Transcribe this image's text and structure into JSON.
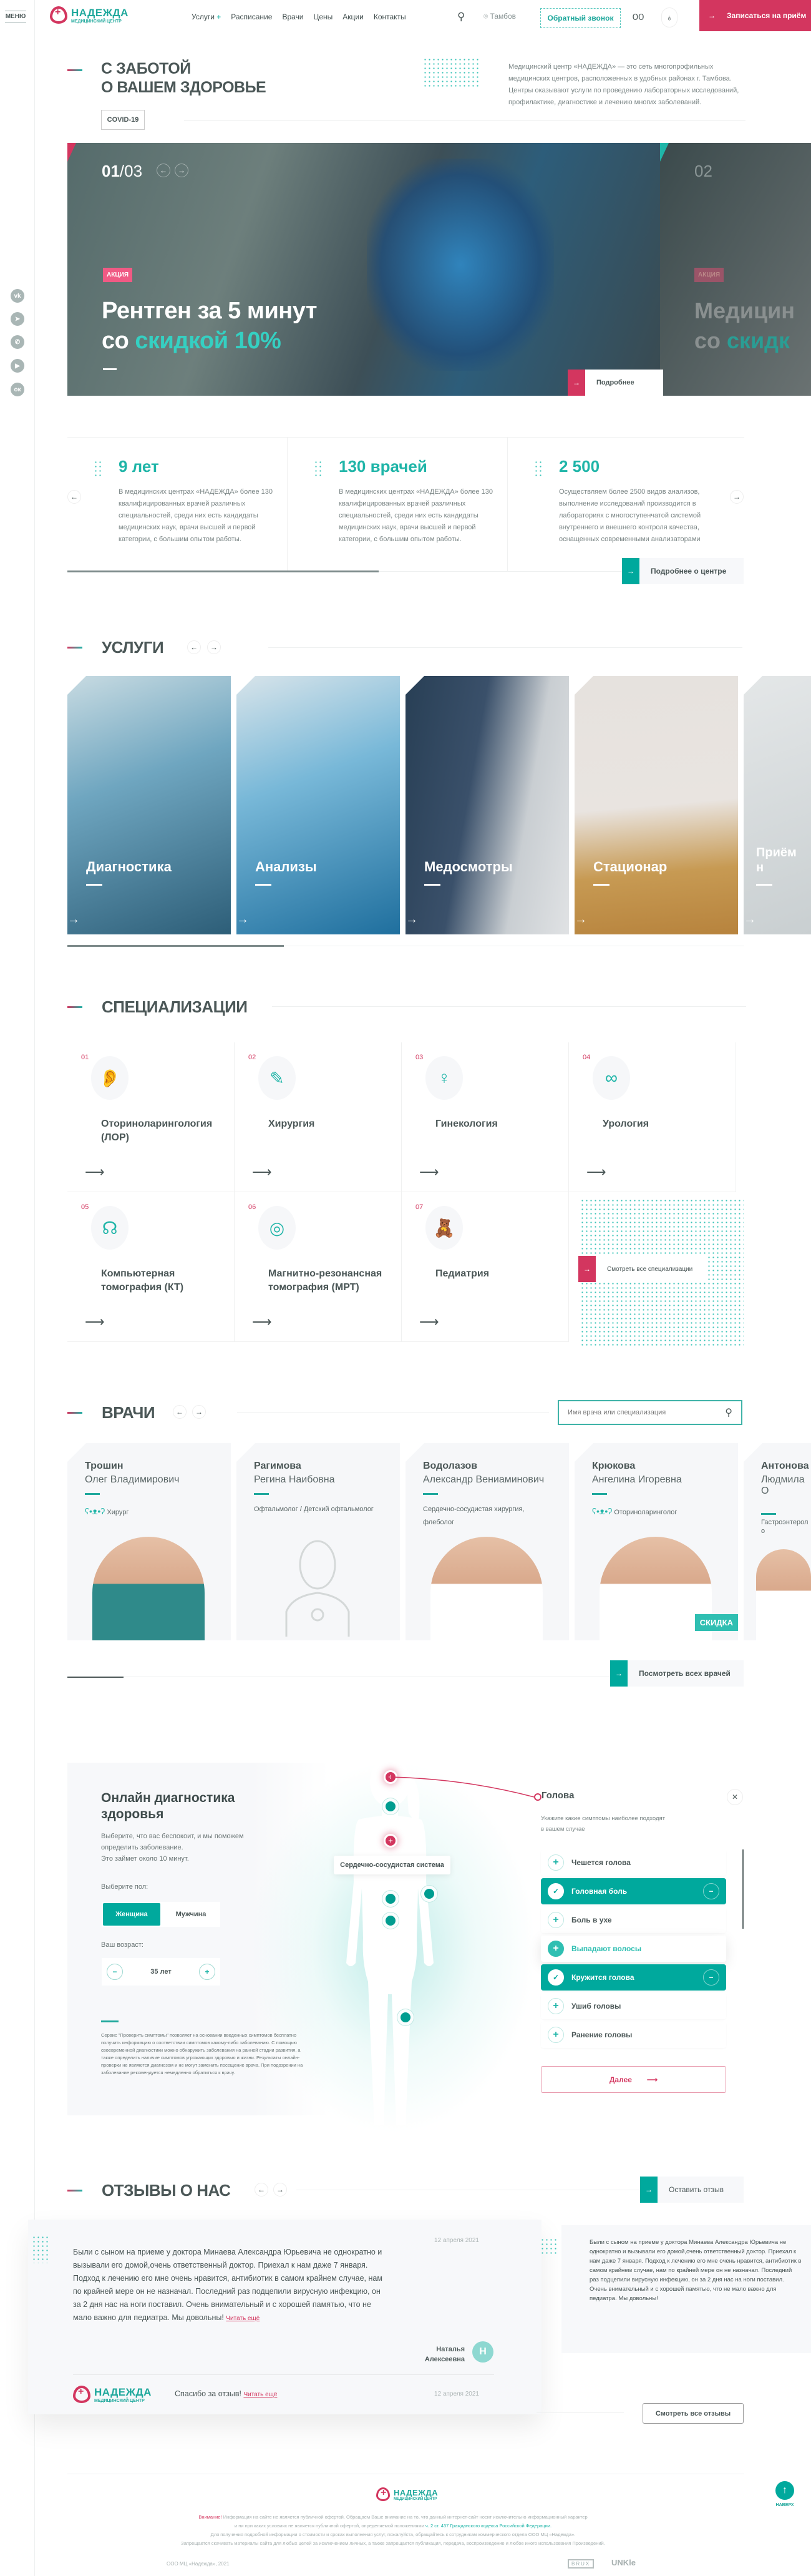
{
  "colors": {
    "teal": "#1fb5a8",
    "pink": "#d3365f",
    "text": "#4b5757"
  },
  "sidebar": {
    "menu_label": "МЕНЮ",
    "social": [
      {
        "icon": "vk-icon",
        "glyph": "vk"
      },
      {
        "icon": "telegram-icon",
        "glyph": "➤"
      },
      {
        "icon": "whatsapp-icon",
        "glyph": "✆"
      },
      {
        "icon": "youtube-icon",
        "glyph": "▶"
      },
      {
        "icon": "odnoklassniki-icon",
        "glyph": "ок"
      }
    ]
  },
  "header": {
    "logo_name": "НАДЕЖДА",
    "logo_sub": "МЕДИЦИНСКИЙ ЦЕНТР",
    "nav": [
      "Услуги",
      "Расписание",
      "Врачи",
      "Цены",
      "Акции",
      "Контакты"
    ],
    "nav_plus": "+",
    "city": "Тамбов",
    "callback": "Обратный звонок",
    "book": "Записаться на приём"
  },
  "intro": {
    "title_line1": "С ЗАБОТОЙ",
    "title_line2": "О ВАШЕМ ЗДОРОВЬЕ",
    "covid": "COVID-19",
    "description": "Медицинский центр «НАДЕЖДА» — это сеть многопрофильных медицинских центров, расположенных в удобных районах г. Тамбова. Центры оказывают услуги по проведению лабораторных исследований, профилактике, диагностике и лечению многих заболеваний."
  },
  "hero": {
    "current": "01",
    "total": "/03",
    "badge": "АКЦИЯ",
    "title_line1": "Рентген за 5 минут",
    "title_pre": "со ",
    "title_accent": "скидкой 10%",
    "more": "Подробнее",
    "next_num": "02",
    "next_badge": "АКЦИЯ",
    "next_title": "Медицин",
    "next_title2_pre": "со ",
    "next_title2_accent": "скидк"
  },
  "stats": {
    "items": [
      {
        "value": "9 лет",
        "text": "В медицинских центрах «НАДЕЖДА» более 130 квалифицированных врачей различных специальностей, среди них есть кандидаты медицинских наук, врачи высшей и первой категории, с большим опытом работы."
      },
      {
        "value": "130 врачей",
        "text": "В медицинских центрах «НАДЕЖДА» более 130 квалифицированных врачей различных специальностей, среди них есть кандидаты медицинских наук, врачи высшей и первой категории, с большим опытом работы."
      },
      {
        "value": "2 500",
        "text": "Осуществляем более 2500 видов анализов, выполнение исследований производится в лабораториях с многоступенчатой системой внутреннего и внешнего контроля качества, оснащенных современными анализаторами"
      }
    ],
    "more": "Подробнее о центре",
    "progress": 0.46
  },
  "services": {
    "title": "УСЛУГИ",
    "items": [
      "Диагностика",
      "Анализы",
      "Медосмотры",
      "Стационар",
      "Приём н"
    ],
    "progress": 0.32
  },
  "specs": {
    "title": "СПЕЦИАЛИЗАЦИИ",
    "items": [
      {
        "num": "01",
        "name": "Оториноларингология (ЛОР)",
        "icon": "ear-icon",
        "glyph": "👂"
      },
      {
        "num": "02",
        "name": "Хирургия",
        "icon": "scalpel-icon",
        "glyph": "✎"
      },
      {
        "num": "03",
        "name": "Гинекология",
        "icon": "uterus-icon",
        "glyph": "♀"
      },
      {
        "num": "04",
        "name": "Урология",
        "icon": "kidneys-icon",
        "glyph": "∞"
      },
      {
        "num": "05",
        "name": "Компьютерная томография (КТ)",
        "icon": "head-brain-icon",
        "glyph": "☊"
      },
      {
        "num": "06",
        "name": "Магнитно-резонансная томография (МРТ)",
        "icon": "mri-scanner-icon",
        "glyph": "◎"
      },
      {
        "num": "07",
        "name": "Педиатрия",
        "icon": "teddy-bear-icon",
        "glyph": "🧸"
      }
    ],
    "all": "Смотреть все специализации"
  },
  "doctors": {
    "title": "ВРАЧИ",
    "search_placeholder": "Имя врача или специализация",
    "items": [
      {
        "surname": "Трошин",
        "name": "Олег Владимирович",
        "spec": "Хирург",
        "kids": true,
        "photo": "#2f8a8a"
      },
      {
        "surname": "Рагимова",
        "name": "Регина Наибовна",
        "spec": "Офтальмолог / Детский офтальмолог",
        "kids": false,
        "photo": ""
      },
      {
        "surname": "Водолазов",
        "name": "Александр Вениаминович",
        "spec": "Сердечно-сосудистая хирургия, флеболог",
        "kids": false,
        "photo": "#ffffff"
      },
      {
        "surname": "Крюкова",
        "name": "Ангелина Игоревна",
        "spec": "Оториноларинголог",
        "kids": true,
        "photo": "#ffffff",
        "badge": "СКИДКА"
      },
      {
        "surname": "Антонова",
        "name": "Людмила О",
        "spec": "Гастроэнтероло",
        "kids": false,
        "photo": "#ffffff"
      }
    ],
    "all": "Посмотреть всех врачей"
  },
  "diag": {
    "title": "Онлайн диагностика здоровья",
    "desc_line1": "Выберите, что вас беспокоит, и мы поможем определить заболевание.",
    "desc_line2": "Это займет около 10 минут.",
    "gender_label": "Выберите пол:",
    "female": "Женщина",
    "male": "Мужчина",
    "age_label": "Ваш возраст:",
    "age": "35 лет",
    "disclaimer": "Сервис \"Проверить симптомы\" позволяет на основании введенных симптомов бесплатно получить информацию о соответствии симптомов какому-либо заболеванию. С помощью своевременной диагностики можно обнаружить заболевания на ранней стадии развития, а также определить наличие симптомов угрожающих здоровью и жизни. Результаты онлайн-проверки не являются диагнозом и не могут заменить посещение врача. При подозрении на заболевание рекомендуется немедленно обратиться к врачу.",
    "tooltip": "Сердечно-сосудистая система",
    "panel_title": "Голова",
    "panel_sub": "Укажите какие симптомы наиболее подходят в вашем случае",
    "symptoms": [
      {
        "label": "Чешется голова",
        "selected": false
      },
      {
        "label": "Головная боль",
        "selected": true
      },
      {
        "label": "Боль в ухе",
        "selected": false
      },
      {
        "label": "Выпадают волосы",
        "selected": false,
        "hover": true
      },
      {
        "label": "Кружится голова",
        "selected": true
      },
      {
        "label": "Ушиб головы",
        "selected": false
      },
      {
        "label": "Ранение головы",
        "selected": false
      }
    ],
    "next": "Далее"
  },
  "reviews": {
    "title": "ОТЗЫВЫ О НАС",
    "leave": "Оставить отзыв",
    "items": [
      {
        "date": "12 апреля 2021",
        "text": "Были с сыном на приеме у доктора Минаева Александра Юрьевича не однократно и вызывали его домой,очень ответственный доктор. Приехал к нам даже 7 января. Подход к лечению его мне очень нравится, антибиотик в самом крайнем случае, нам по крайней мере он не назначал. Последний раз подцепили вирусную инфекцию, он за 2 дня нас на ноги поставил. Очень внимательный и с хорошей памятью, что не мало важно для педиатра. Мы довольны!",
        "more": "Читать ещё",
        "author_line1": "Наталья",
        "author_line2": "Алексеевна",
        "initial": "Н",
        "reply": "Спасибо за отзыв!",
        "reply_more": "Читать ещё",
        "reply_date": "12 апреля 2021"
      },
      {
        "text": "Были с сыном на приеме у доктора Минаева Александра Юрьевича не однократно и вызывали его домой,очень ответственный доктор. Приехал к нам даже 7 января. Подход к лечению его мне очень нравится, антибиотик в самом крайнем случае, нам по крайней мере он не назначал. Последний раз подцепили вирусную инфекцию, он за 2 дня нас на ноги поставил. Очень внимательный и с хорошей памятью, что не мало важно для педиатра. Мы довольны!"
      }
    ],
    "all": "Смотреть все отзывы"
  },
  "footer": {
    "warn": "Внимание!",
    "line1": " Информация на сайте не является публичной офертой. Обращаем Ваше внимание на то, что данный интернет-сайт носит исключительно информационный характер",
    "line2": "и ни при каких условиях не является публичной офертой, определяемой положениями ",
    "law": "ч. 2 ст. 437 Гражданского кодекса Российской Федерации.",
    "line3": "Для получения подробной информации о стоимости и сроках выполнения услуг, пожалуйста, обращайтесь к сотрудникам коммерческого отдела ООО МЦ «Надежда».",
    "line4": "Запрещается скачивать материалы сайта для любых целей за исключением личных, а также запрещается публикация, передача, воспроизведение и любое иного использования Произведений.",
    "copy": "ООО МЦ «Надежда», 2021",
    "dev1": "BRUX",
    "dev2": "UNKle",
    "top": "НАВЕРХ"
  }
}
